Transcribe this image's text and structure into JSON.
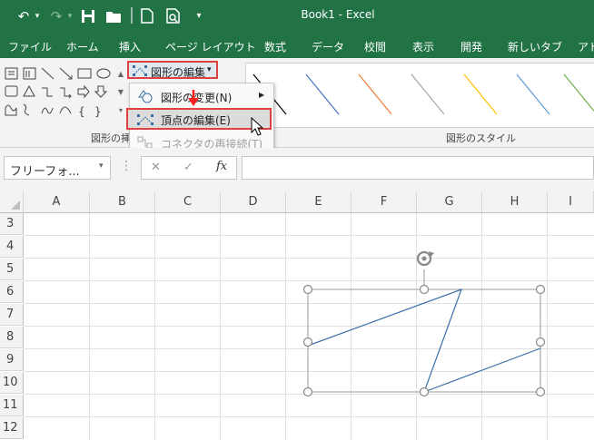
{
  "window": {
    "title": "Book1  -  Excel"
  },
  "ribbon_tabs": [
    "ファイル",
    "ホーム",
    "挿入",
    "ページ レイアウト",
    "数式",
    "データ",
    "校閲",
    "表示",
    "開発",
    "新しいタブ",
    "アド"
  ],
  "ribbon": {
    "edit_shape_label": "図形の編集",
    "insert_shapes_group_label": "図形の挿",
    "shape_styles_group_label": "図形のスタイル"
  },
  "edit_shape_menu": {
    "items": [
      {
        "label": "図形の変更(N)",
        "enabled": true,
        "has_submenu": true
      },
      {
        "label": "頂点の編集(E)",
        "enabled": true,
        "highlighted": true
      },
      {
        "label": "コネクタの再接続(T)",
        "enabled": false
      }
    ]
  },
  "formula_bar": {
    "name_box": "フリーフォ...",
    "fx": "fx",
    "cancel": "✕",
    "enter": "✓",
    "formula": ""
  },
  "grid": {
    "columns": [
      "A",
      "B",
      "C",
      "D",
      "E",
      "F",
      "G",
      "H",
      "I"
    ],
    "rows": [
      "3",
      "4",
      "5",
      "6",
      "7",
      "8",
      "9",
      "10",
      "11",
      "12"
    ]
  },
  "colors": {
    "accent": "#217346",
    "highlight_border": "#e04040",
    "shape_line": "#3a6ea5"
  }
}
